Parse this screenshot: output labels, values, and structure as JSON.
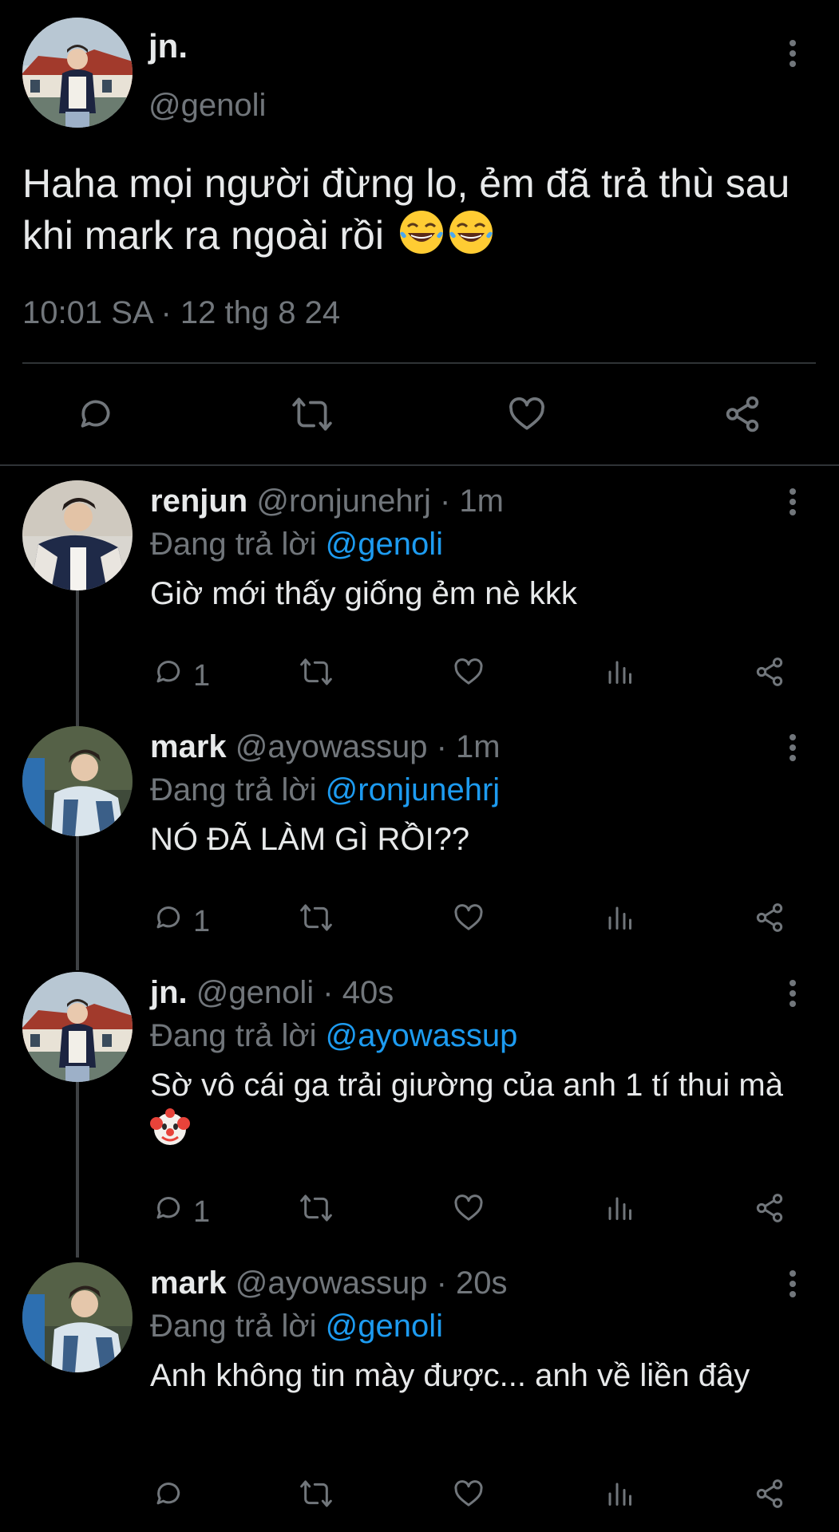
{
  "main_tweet": {
    "author_name": "jn.",
    "handle": "@genoli",
    "text": "Haha mọi người đừng lo, ẻm đã trả thù sau khi mark ra ngoài rồi",
    "emoji": "😂😂",
    "timestamp": "10:01 SA · 12 thg 8 24",
    "actions": [
      "reply-icon",
      "retweet-icon",
      "like-icon",
      "share-icon"
    ]
  },
  "replies": [
    {
      "name": "renjun",
      "handle": "@ronjunehrj",
      "time": "· 1m",
      "replying_prefix": "Đang trả lời",
      "replying_to": "@genoli",
      "text": "Giờ mới thấy giống ẻm nè kkk",
      "emoji": "",
      "reply_count": "1"
    },
    {
      "name": "mark",
      "handle": "@ayowassup",
      "time": "· 1m",
      "replying_prefix": "Đang trả lời",
      "replying_to": "@ronjunehrj",
      "text": "NÓ ĐÃ LÀM GÌ RỒI??",
      "emoji": "",
      "reply_count": "1"
    },
    {
      "name": "jn.",
      "handle": "@genoli",
      "time": "· 40s",
      "replying_prefix": "Đang trả lời",
      "replying_to": "@ayowassup",
      "text": "Sờ vô cái ga trải giường của anh 1 tí thui mà",
      "emoji": "🤡",
      "reply_count": "1"
    },
    {
      "name": "mark",
      "handle": "@ayowassup",
      "time": "· 20s",
      "replying_prefix": "Đang trả lời",
      "replying_to": "@genoli",
      "text": "Anh không tin mày được... anh về liền đây",
      "emoji": "",
      "reply_count": ""
    }
  ],
  "colors": {
    "background": "#000000",
    "text": "#e7e9ea",
    "secondary": "#71767b",
    "mention": "#1d9bf0",
    "divider": "#2f3336"
  }
}
